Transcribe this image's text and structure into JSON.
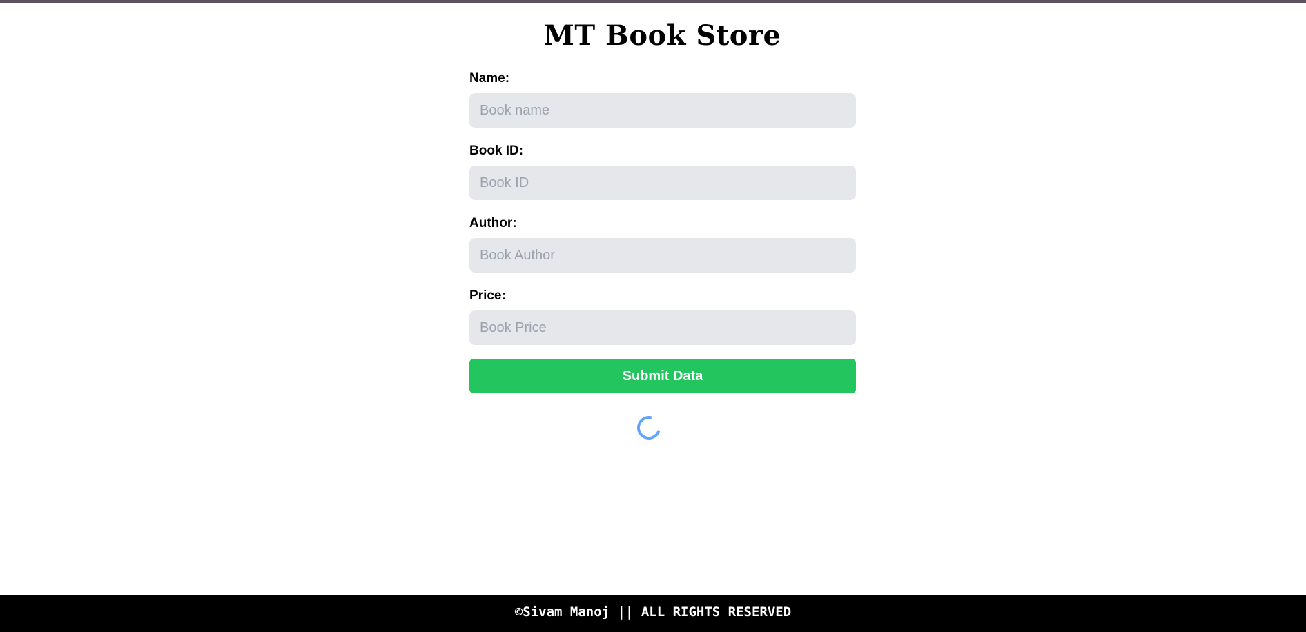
{
  "app": {
    "title": "MT Book Store"
  },
  "form": {
    "fields": [
      {
        "label": "Name:",
        "placeholder": "Book name",
        "value": ""
      },
      {
        "label": "Book ID:",
        "placeholder": "Book ID",
        "value": ""
      },
      {
        "label": "Author:",
        "placeholder": "Book Author",
        "value": ""
      },
      {
        "label": "Price:",
        "placeholder": "Book Price",
        "value": ""
      }
    ],
    "submit_label": "Submit Data"
  },
  "status": {
    "loading_icon": "spinner-icon",
    "color": "#60a5fa"
  },
  "footer": {
    "text": "©Sivam Manoj || ALL RIGHTS RESERVED"
  },
  "colors": {
    "accent": "#22c55e",
    "input_bg": "#e5e7eb",
    "footer_bg": "#000000",
    "top_bar": "#5f5260"
  }
}
